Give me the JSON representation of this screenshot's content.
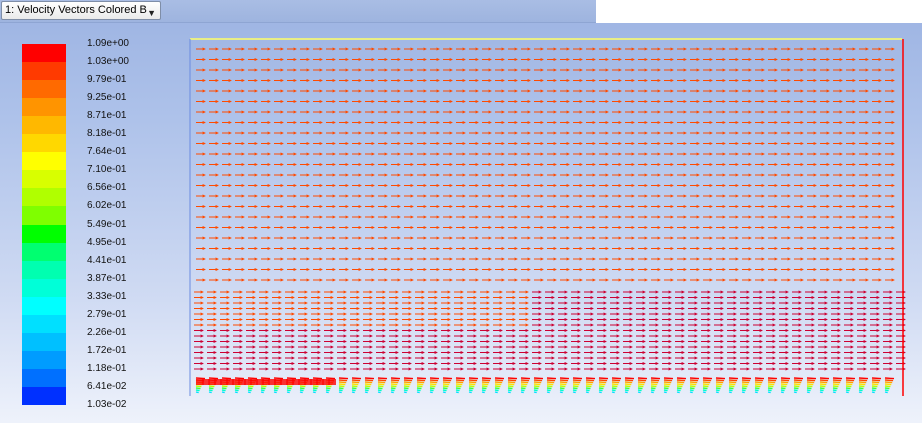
{
  "window_selector": {
    "label": "1: Velocity Vectors Colored B",
    "icon": "chevron-down-icon"
  },
  "legend": {
    "ticks": [
      "1.09e+00",
      "1.03e+00",
      "9.79e-01",
      "9.25e-01",
      "8.71e-01",
      "8.18e-01",
      "7.64e-01",
      "7.10e-01",
      "6.56e-01",
      "6.02e-01",
      "5.49e-01",
      "4.95e-01",
      "4.41e-01",
      "3.87e-01",
      "3.33e-01",
      "2.79e-01",
      "2.26e-01",
      "1.72e-01",
      "1.18e-01",
      "6.41e-02",
      "1.03e-02"
    ],
    "colors": [
      "#ff0000",
      "#ff3a00",
      "#ff6a00",
      "#ff9400",
      "#ffb800",
      "#ffd800",
      "#ffff00",
      "#d8ff00",
      "#b0ff00",
      "#7fff00",
      "#00ff00",
      "#00ff70",
      "#00ffb0",
      "#00ffd8",
      "#00ffff",
      "#00e0ff",
      "#00c0ff",
      "#009cff",
      "#0070ff",
      "#0030ff"
    ]
  },
  "colors": {
    "vector_far_field": "#ff4a00",
    "vector_near_wall": "#cc0033",
    "domain_top_edge": "#ffff66",
    "domain_left_edge": "#6a8be0",
    "domain_right_edge": "#ff0000"
  }
}
